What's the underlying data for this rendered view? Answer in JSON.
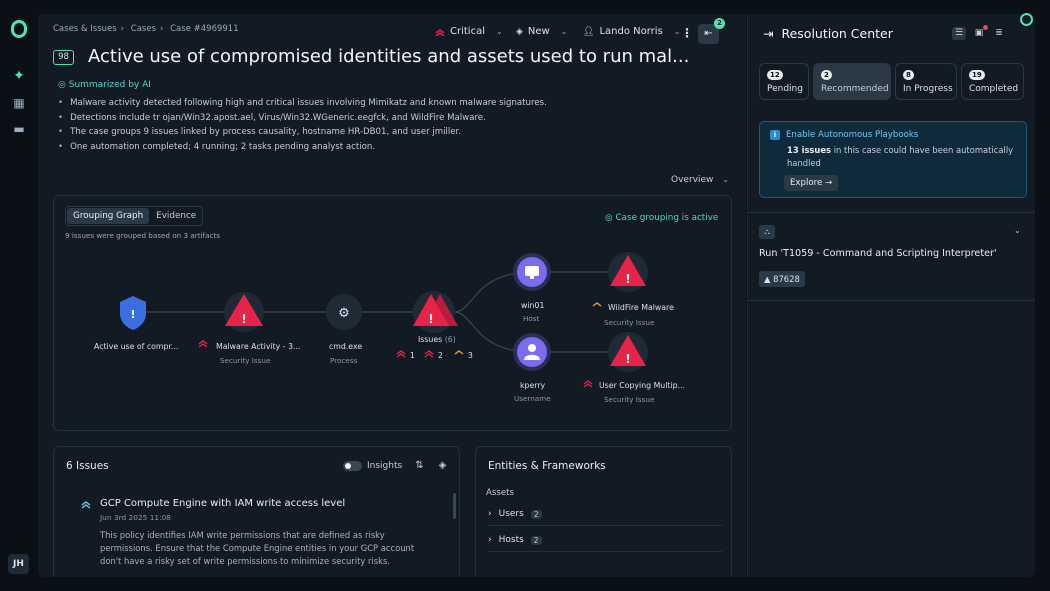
{
  "breadcrumb": [
    "Cases & Issues",
    "Cases",
    "Case #4969911"
  ],
  "header": {
    "severity": "Critical",
    "status": "New",
    "assignee": "Lando Norris",
    "notifications_count": "2"
  },
  "case": {
    "number": "98",
    "title": "Active use of compromised identities and assets used to run mal..."
  },
  "summary": {
    "label": "Summarized by AI",
    "bullets": [
      "Malware activity detected following high and critical issues involving Mimikatz and known malware signatures.",
      "Detections include tr ojan/Win32.apost.ael, Virus/Win32.WGeneric.eegfck, and WildFire Malware.",
      "The case groups 9 issues linked by process causality, hostname HR-DB01, and user jmiller.",
      "One automation completed; 4 running; 2 tasks pending analyst action."
    ]
  },
  "overview_label": "Overview",
  "graph": {
    "tabs": [
      "Grouping Graph",
      "Evidence"
    ],
    "note": "9 issues were grouped based on 3 artifacts",
    "status": "Case grouping is active",
    "nodes": {
      "case": {
        "label": "Active use of compr..."
      },
      "malware": {
        "label": "Malware Activity - 3...",
        "sub": "Security Issue"
      },
      "cmd": {
        "label": "cmd.exe",
        "sub": "Process"
      },
      "issues": {
        "label": "Issues",
        "count": "(6)",
        "c1": "1",
        "c2": "2",
        "c3": "3"
      },
      "win01": {
        "label": "win01",
        "sub": "Host"
      },
      "kperry": {
        "label": "kperry",
        "sub": "Username"
      },
      "wildfire": {
        "label": "WildFire Malware",
        "sub": "Security Issue"
      },
      "usercopy": {
        "label": "User Copying Multip...",
        "sub": "Security Issue"
      }
    }
  },
  "issues_panel": {
    "title": "6 Issues",
    "insights": "Insights",
    "item": {
      "title": "GCP Compute Engine with IAM write access level",
      "date": "Jun 3rd 2025 11:08",
      "desc": "This policy identifies IAM write permissions that are defined as risky permissions. Ensure that the Compute Engine entities in your GCP account don't have a risky set of write permissions to minimize security risks."
    }
  },
  "entities_panel": {
    "title": "Entities & Frameworks",
    "section": "Assets",
    "rows": [
      {
        "label": "Users",
        "count": "2"
      },
      {
        "label": "Hosts",
        "count": "2"
      }
    ]
  },
  "resolution": {
    "title": "Resolution Center",
    "tabs": [
      {
        "count": "12",
        "label": "Pending"
      },
      {
        "count": "2",
        "label": "Recommended"
      },
      {
        "count": "8",
        "label": "In Progress"
      },
      {
        "count": "19",
        "label": "Completed"
      }
    ],
    "auto": {
      "heading": "Enable Autonomous Playbooks",
      "count_text": "13 issues",
      "body": " in this case could have been automatically handled",
      "button": "Explore →"
    },
    "task": {
      "title": "Run 'T1059 - Command and Scripting Interpreter'",
      "id": "87628"
    }
  },
  "colors": {
    "accent": "#4fe3b0",
    "critical": "#e8234a",
    "info": "#6cc8f4",
    "teal": "#4fd6c8"
  },
  "user_initials": "JH"
}
